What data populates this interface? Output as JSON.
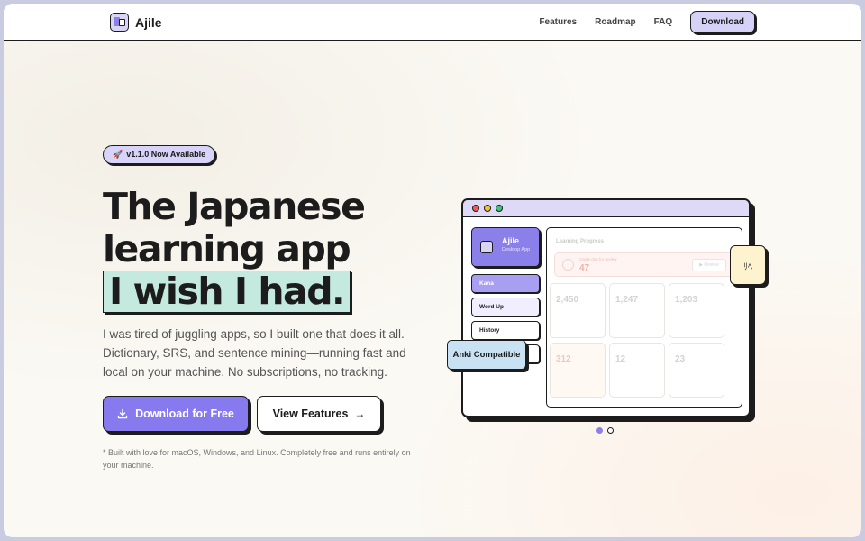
{
  "header": {
    "brand": "Ajile",
    "nav": [
      "Features",
      "Roadmap",
      "FAQ"
    ],
    "download_label": "Download"
  },
  "hero": {
    "badge_icon": "rocket-icon",
    "badge_label": "v1.1.0 Now Available",
    "title_line1": "The Japanese",
    "title_line2": "learning app",
    "title_highlight": "I wish I had.",
    "description": "I was tired of juggling apps, so I built one that does it all. Dictionary, SRS, and sentence mining—running fast and local on your machine. No subscriptions, no tracking.",
    "primary_cta": "Download for Free",
    "secondary_cta": "View Features",
    "footnote": "* Built with love for macOS, Windows, and Linux. Completely free and runs entirely on your machine."
  },
  "mockup": {
    "app_name": "Ajile",
    "app_subtitle": "Desktop App",
    "sidebar": [
      "Kana",
      "Word Up",
      "History"
    ],
    "panel_title": "Learning Progress",
    "review_label": "Cards due for review",
    "review_count": "47",
    "review_button": "Review",
    "stats": [
      "2,450",
      "1,247",
      "1,203",
      "312",
      "12",
      "23"
    ],
    "kanji_badge": "ﾘﾍ",
    "anki_badge": "Anki Compatible"
  },
  "colors": {
    "accent": "#877aef",
    "badge_bg": "#d8d3f8",
    "highlight_bg": "#c4e9df",
    "anki_bg": "#c9e2f3",
    "kanji_bg": "#fdf3cf"
  }
}
